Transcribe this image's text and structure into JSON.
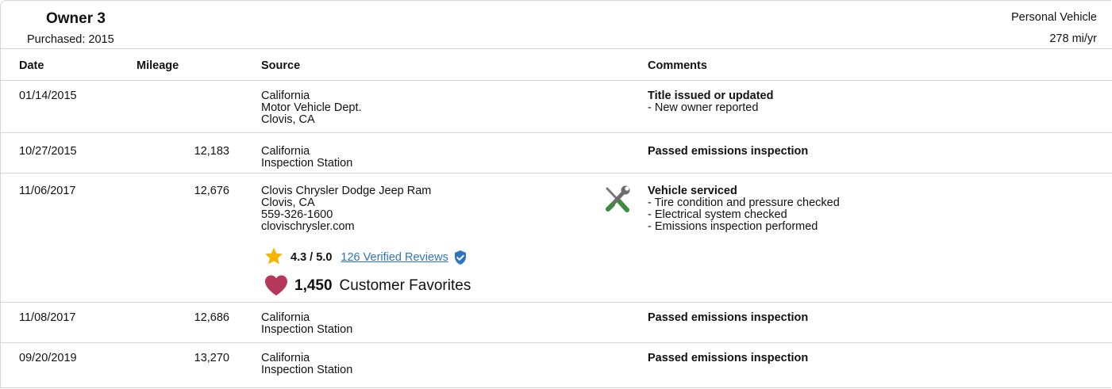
{
  "owner": {
    "title": "Owner 3",
    "purchased": "Purchased: 2015",
    "usage_type": "Personal Vehicle",
    "usage_miles": "278 mi/yr"
  },
  "table": {
    "headers": {
      "date": "Date",
      "mileage": "Mileage",
      "source": "Source",
      "comments": "Comments"
    },
    "rows": [
      {
        "date": "01/14/2015",
        "mileage": "",
        "source": [
          "California",
          "Motor Vehicle Dept.",
          "Clovis, CA"
        ],
        "comment_title": "Title issued or updated",
        "comment_items": [
          "- New owner reported"
        ]
      },
      {
        "date": "10/27/2015",
        "mileage": "12,183",
        "source": [
          "California",
          "Inspection Station"
        ],
        "comment_title": "Passed emissions inspection",
        "comment_items": []
      },
      {
        "date": "11/06/2017",
        "mileage": "12,676",
        "source": [
          "Clovis Chrysler Dodge Jeep Ram",
          "Clovis, CA",
          "559-326-1600",
          "clovischrysler.com"
        ],
        "comment_title": "Vehicle serviced",
        "comment_items": [
          "- Tire condition and pressure checked",
          "- Electrical system checked",
          "- Emissions inspection performed"
        ],
        "icon": "wrench-screwdriver-icon",
        "rating": {
          "score": "4.3 / 5.0",
          "reviews_link": "126 Verified Reviews",
          "icon": "star-icon",
          "verified_icon": "shield-check-icon"
        },
        "favorites": {
          "count": "1,450",
          "label": "Customer Favorites",
          "icon": "heart-icon"
        }
      },
      {
        "date": "11/08/2017",
        "mileage": "12,686",
        "source": [
          "California",
          "Inspection Station"
        ],
        "comment_title": "Passed emissions inspection",
        "comment_items": []
      },
      {
        "date": "09/20/2019",
        "mileage": "13,270",
        "source": [
          "California",
          "Inspection Station"
        ],
        "comment_title": "Passed emissions inspection",
        "comment_items": []
      }
    ]
  },
  "colors": {
    "border": "#d4d4d4",
    "link": "#2f74c0",
    "star": "#f5b400",
    "heart": "#b5375c",
    "shield": "#2f74c0"
  }
}
